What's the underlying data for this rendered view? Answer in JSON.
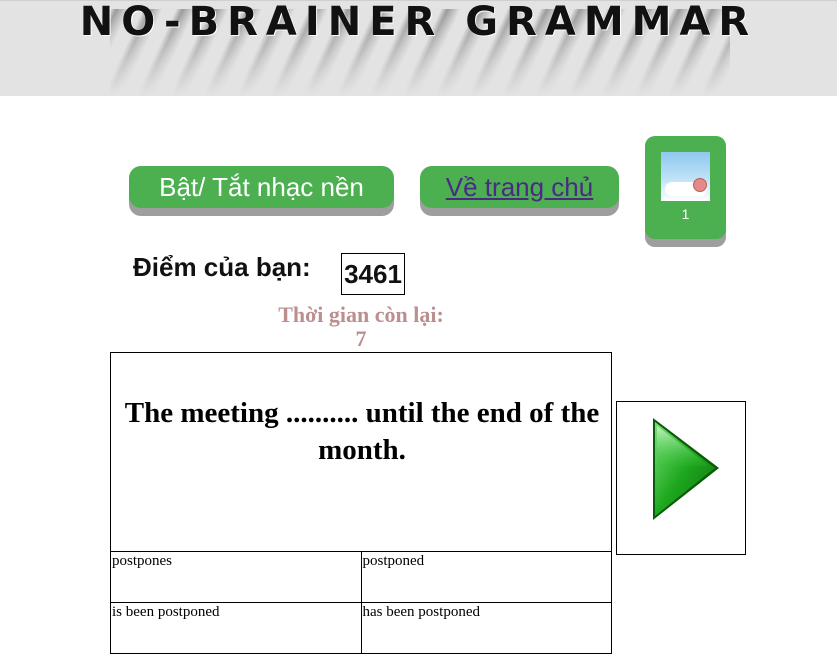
{
  "header": {
    "title": "NO-BRAINER GRAMMAR"
  },
  "controls": {
    "music_toggle_label": "Bật/ Tắt nhạc nền",
    "home_link_label": "Về trang chủ",
    "avatar_count": "1"
  },
  "score": {
    "label": "Điểm của bạn:",
    "value": "3461"
  },
  "timer": {
    "label": "Thời gian còn lại:",
    "value": "7"
  },
  "question": {
    "text": "The meeting .......... until the end of the month."
  },
  "answers": [
    "postpones",
    "postponed",
    "is been postponed",
    "has been postponed"
  ],
  "next": {
    "icon": "play-arrow-icon",
    "color": "#1fa81f"
  },
  "colors": {
    "button": "#4caf50",
    "timer": "#bc8f8f",
    "header_bg": "#e4e3e3"
  }
}
